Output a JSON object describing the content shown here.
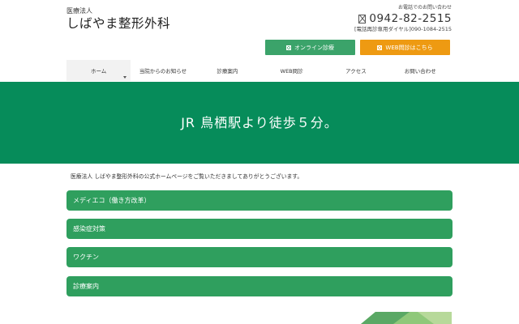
{
  "logo": {
    "sub": "医療法人",
    "main": "しばやま整形外科"
  },
  "contact": {
    "label": "お電話でのお問い合わせ",
    "phone": "0942-82-2515",
    "mobile": "[電話再診専用ダイヤル]090-1084-2515"
  },
  "buttons": {
    "online": "オンライン診療",
    "web": "WEB問診はこちら"
  },
  "nav": [
    "ホーム",
    "当院からのお知らせ",
    "診療案内",
    "WEB問診",
    "アクセス",
    "お問い合わせ"
  ],
  "hero": {
    "text": "JR 鳥栖駅より徒歩５分。"
  },
  "intro": "医療法人 しばやま整形外科の公式ホームページをご覧いただきましてありがとうございます。",
  "accordion": [
    "メディエコ（働き方改革）",
    "感染症対策",
    "ワクチン",
    "診療案内"
  ],
  "colors": {
    "green": "#068c5a",
    "accordion": "#2f9f5e",
    "online_button": "#3ba36a",
    "web_button": "#ee9a12"
  }
}
